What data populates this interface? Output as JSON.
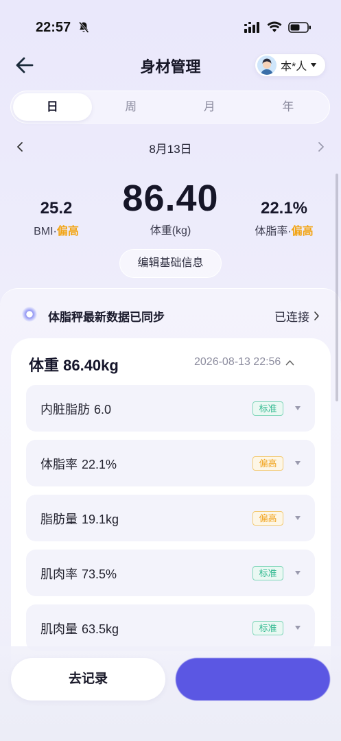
{
  "status_bar": {
    "time": "22:57"
  },
  "header": {
    "title": "身材管理",
    "member_name": "本*人"
  },
  "tabs": [
    {
      "label": "日",
      "active": true
    },
    {
      "label": "周",
      "active": false
    },
    {
      "label": "月",
      "active": false
    },
    {
      "label": "年",
      "active": false
    }
  ],
  "date": {
    "label": "8月13日"
  },
  "summary": {
    "weight_value": "86.40",
    "weight_label": "体重(kg)",
    "bmi_value": "25.2",
    "bmi_label": "BMI",
    "bmi_status": "偏高",
    "fat_value": "22.1%",
    "fat_label": "体脂率",
    "fat_status": "偏高",
    "separator": "·",
    "edit_label": "编辑基础信息"
  },
  "sync": {
    "text": "体脂秤最新数据已同步",
    "connection": "已连接"
  },
  "detail": {
    "title": "体重 86.40kg",
    "timestamp": "2026-08-13 22:56",
    "metrics": [
      {
        "name": "内脏脂肪",
        "value": "6.0",
        "status": "标准"
      },
      {
        "name": "体脂率",
        "value": "22.1%",
        "status": "偏高"
      },
      {
        "name": "脂肪量",
        "value": "19.1kg",
        "status": "偏高"
      },
      {
        "name": "肌肉率",
        "value": "73.5%",
        "status": "标准"
      },
      {
        "name": "肌肉量",
        "value": "63.5kg",
        "status": "标准"
      }
    ]
  },
  "actions": {
    "record_label": "去记录",
    "measure_label": ""
  },
  "colors": {
    "accent": "#5b57e3",
    "warning": "#f2a516",
    "normal": "#2fb88f"
  }
}
